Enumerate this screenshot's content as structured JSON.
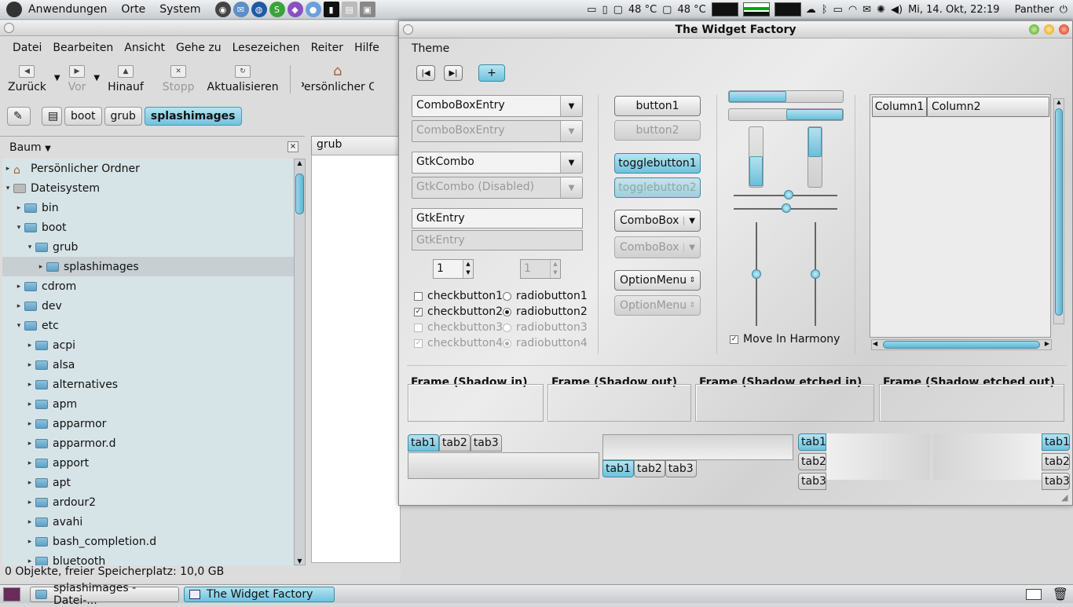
{
  "top_panel": {
    "menus": [
      "Anwendungen",
      "Orte",
      "System"
    ],
    "temp1": "48 °C",
    "temp2": "48 °C",
    "clock": "Mi, 14. Okt, 22:19",
    "user": "Panther"
  },
  "nautilus": {
    "menubar": [
      "Datei",
      "Bearbeiten",
      "Ansicht",
      "Gehe zu",
      "Lesezeichen",
      "Reiter",
      "Hilfe"
    ],
    "toolbar": {
      "back": "Zurück",
      "forward": "Vor",
      "up": "Hinauf",
      "stop": "Stopp",
      "reload": "Aktualisieren",
      "home": "Persönlicher O"
    },
    "breadcrumbs": [
      "boot",
      "grub",
      "splashimages"
    ],
    "sidepane_title": "Baum",
    "tab_title": "grub",
    "tree": [
      {
        "label": "Persönlicher Ordner",
        "level": 0,
        "exp": "▸"
      },
      {
        "label": "Dateisystem",
        "level": 0,
        "exp": "▾"
      },
      {
        "label": "bin",
        "level": 1,
        "exp": "▸"
      },
      {
        "label": "boot",
        "level": 1,
        "exp": "▾"
      },
      {
        "label": "grub",
        "level": 2,
        "exp": "▾"
      },
      {
        "label": "splashimages",
        "level": 3,
        "exp": "▸"
      },
      {
        "label": "cdrom",
        "level": 1,
        "exp": "▸"
      },
      {
        "label": "dev",
        "level": 1,
        "exp": "▸"
      },
      {
        "label": "etc",
        "level": 1,
        "exp": "▾"
      },
      {
        "label": "acpi",
        "level": 2,
        "exp": "▸"
      },
      {
        "label": "alsa",
        "level": 2,
        "exp": "▸"
      },
      {
        "label": "alternatives",
        "level": 2,
        "exp": "▸"
      },
      {
        "label": "apm",
        "level": 2,
        "exp": "▸"
      },
      {
        "label": "apparmor",
        "level": 2,
        "exp": "▸"
      },
      {
        "label": "apparmor.d",
        "level": 2,
        "exp": "▸"
      },
      {
        "label": "apport",
        "level": 2,
        "exp": "▸"
      },
      {
        "label": "apt",
        "level": 2,
        "exp": "▸"
      },
      {
        "label": "ardour2",
        "level": 2,
        "exp": "▸"
      },
      {
        "label": "avahi",
        "level": 2,
        "exp": "▸"
      },
      {
        "label": "bash_completion.d",
        "level": 2,
        "exp": "▸"
      },
      {
        "label": "bluetooth",
        "level": 2,
        "exp": "▸"
      }
    ],
    "status": "0 Objekte, freier Speicherplatz: 10,0 GB"
  },
  "widget_factory": {
    "title": "The Widget Factory",
    "menu_theme": "Theme",
    "combo_entry": "ComboBoxEntry",
    "combo_entry_dis": "ComboBoxEntry",
    "gtkcombo": "GtkCombo",
    "gtkcombo_dis": "GtkCombo (Disabled)",
    "entry": "GtkEntry",
    "entry_dis": "GtkEntry",
    "spin1": "1",
    "spin2": "1",
    "check1": "checkbutton1",
    "check2": "checkbutton2",
    "check3": "checkbutton3",
    "check4": "checkbutton4",
    "radio1": "radiobutton1",
    "radio2": "radiobutton2",
    "radio3": "radiobutton3",
    "radio4": "radiobutton4",
    "button1": "button1",
    "button2": "button2",
    "toggle1": "togglebutton1",
    "toggle2": "togglebutton2",
    "combobox": "ComboBox",
    "combobox_dis": "ComboBox",
    "option": "OptionMenu",
    "option_dis": "OptionMenu",
    "harmony": "Move In Harmony",
    "col1": "Column1",
    "col2": "Column2",
    "frames": [
      "Frame (Shadow in)",
      "Frame (Shadow out)",
      "Frame (Shadow etched in)",
      "Frame (Shadow etched out)"
    ],
    "tabs": [
      "tab1",
      "tab2",
      "tab3"
    ]
  },
  "taskbar": {
    "tasks": [
      "splashimages - Datei-...",
      "The Widget Factory"
    ]
  }
}
